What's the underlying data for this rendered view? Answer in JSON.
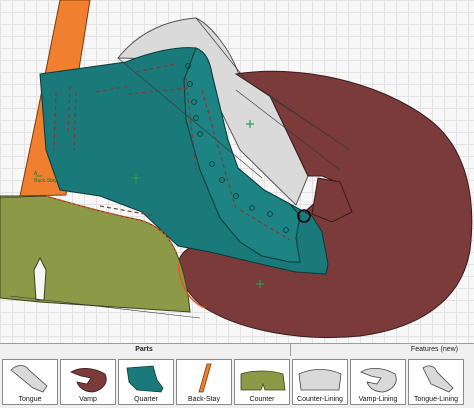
{
  "canvas": {
    "piece_labels": {
      "back_stay": "Back-Stay",
      "back_stay_prefix": "A\nA"
    }
  },
  "panel": {
    "parts_tab": "Parts",
    "features_tab": "Features (new)",
    "parts": [
      {
        "name": "Tongue",
        "color": "#d9d9d9"
      },
      {
        "name": "Vamp",
        "color": "#7b3b3b"
      },
      {
        "name": "Quarter",
        "color": "#1a7a7a"
      },
      {
        "name": "Back-Stay",
        "color": "#f08030"
      },
      {
        "name": "Counter",
        "color": "#8c9a48"
      },
      {
        "name": "Counter-Lining",
        "color": "#d9d9d9"
      },
      {
        "name": "Vamp-Lining",
        "color": "#d9d9d9"
      },
      {
        "name": "Tongue-Lining",
        "color": "#d9d9d9"
      }
    ]
  },
  "colors": {
    "tongue": "#d9d9d9",
    "vamp": "#7b3b3b",
    "quarter": "#1a7a7a",
    "back_stay": "#f08030",
    "counter": "#8c9a48",
    "selection_outline": "#000000"
  }
}
